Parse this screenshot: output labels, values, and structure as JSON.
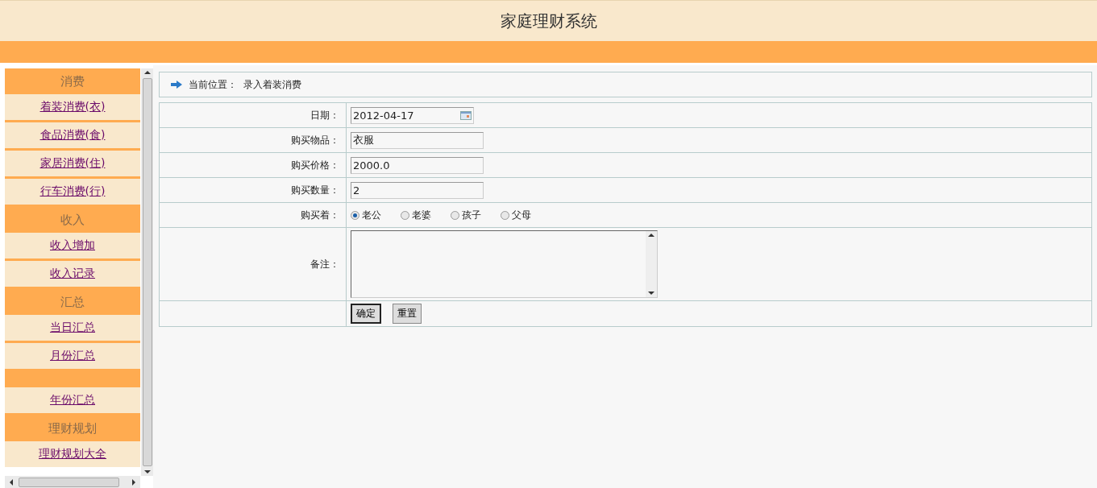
{
  "header": {
    "title": "家庭理财系统"
  },
  "sidebar": {
    "items": [
      {
        "kind": "header",
        "label": "消费"
      },
      {
        "kind": "link",
        "label": "着装消费(衣)"
      },
      {
        "kind": "link",
        "label": "食品消费(食)"
      },
      {
        "kind": "link",
        "label": "家居消费(住)"
      },
      {
        "kind": "link",
        "label": "行车消费(行)"
      },
      {
        "kind": "header",
        "label": "收入"
      },
      {
        "kind": "link",
        "label": "收入增加"
      },
      {
        "kind": "link",
        "label": "收入记录"
      },
      {
        "kind": "header",
        "label": "汇总"
      },
      {
        "kind": "link",
        "label": "当日汇总"
      },
      {
        "kind": "link",
        "label": "月份汇总"
      },
      {
        "kind": "blank"
      },
      {
        "kind": "link",
        "label": "年份汇总"
      },
      {
        "kind": "header",
        "label": "理财规划"
      },
      {
        "kind": "link",
        "label": "理财规划大全"
      }
    ]
  },
  "breadcrumb": {
    "label": "当前位置：",
    "value": "录入着装消费"
  },
  "form": {
    "fields": [
      {
        "kind": "date",
        "label": "日期：",
        "value": "2012-04-17"
      },
      {
        "kind": "text",
        "label": "购买物品：",
        "value": "衣服"
      },
      {
        "kind": "text",
        "label": "购买价格：",
        "value": "2000.0"
      },
      {
        "kind": "text",
        "label": "购买数量：",
        "value": "2"
      },
      {
        "kind": "radio",
        "label": "购买着：",
        "options": [
          {
            "label": "老公",
            "selected": true
          },
          {
            "label": "老婆",
            "selected": false
          },
          {
            "label": "孩子",
            "selected": false
          },
          {
            "label": "父母",
            "selected": false
          }
        ]
      },
      {
        "kind": "textarea",
        "label": "备注："
      }
    ],
    "buttons": [
      "确定",
      "重置"
    ]
  }
}
